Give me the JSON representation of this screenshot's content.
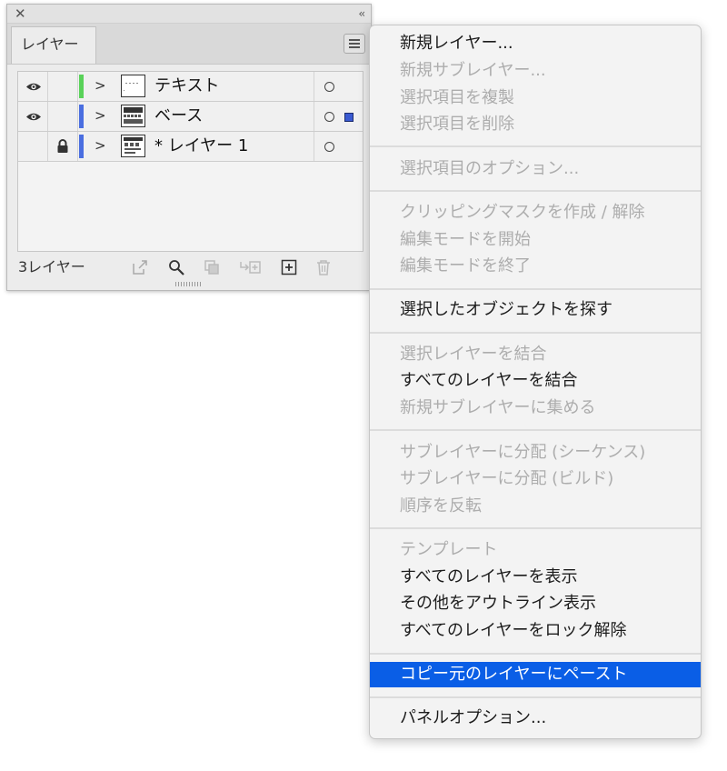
{
  "panel": {
    "tab_label": "レイヤー",
    "layers": [
      {
        "name": "テキスト",
        "visible": true,
        "locked": false,
        "color": "#59d259",
        "selected": false
      },
      {
        "name": "ベース",
        "visible": true,
        "locked": false,
        "color": "#4a6ee0",
        "selected": true
      },
      {
        "name": "* レイヤー 1",
        "visible": false,
        "locked": true,
        "color": "#4a6ee0",
        "selected": false
      }
    ],
    "layer_count": "3レイヤー",
    "footer_icons": [
      "export-icon",
      "search-icon",
      "collect-icon",
      "move-to-sublayer-icon",
      "new-layer-icon",
      "trash-icon"
    ]
  },
  "menu": {
    "items": [
      {
        "label": "新規レイヤー...",
        "enabled": true
      },
      {
        "label": "新規サブレイヤー...",
        "enabled": false
      },
      {
        "label": "選択項目を複製",
        "enabled": false
      },
      {
        "label": "選択項目を削除",
        "enabled": false
      },
      {
        "label": "選択項目のオプション...",
        "enabled": false
      },
      {
        "label": "クリッピングマスクを作成 / 解除",
        "enabled": false
      },
      {
        "label": "編集モードを開始",
        "enabled": false
      },
      {
        "label": "編集モードを終了",
        "enabled": false
      },
      {
        "label": "選択したオブジェクトを探す",
        "enabled": true
      },
      {
        "label": "選択レイヤーを結合",
        "enabled": false
      },
      {
        "label": "すべてのレイヤーを結合",
        "enabled": true
      },
      {
        "label": "新規サブレイヤーに集める",
        "enabled": false
      },
      {
        "label": "サブレイヤーに分配 (シーケンス)",
        "enabled": false
      },
      {
        "label": "サブレイヤーに分配 (ビルド)",
        "enabled": false
      },
      {
        "label": "順序を反転",
        "enabled": false
      },
      {
        "label": "テンプレート",
        "enabled": false
      },
      {
        "label": "すべてのレイヤーを表示",
        "enabled": true
      },
      {
        "label": "その他をアウトライン表示",
        "enabled": true
      },
      {
        "label": "すべてのレイヤーをロック解除",
        "enabled": true
      },
      {
        "label": "コピー元のレイヤーにペースト",
        "enabled": true,
        "highlighted": true
      },
      {
        "label": "パネルオプション...",
        "enabled": true
      }
    ],
    "highlight_color": "#0a5ee6"
  }
}
